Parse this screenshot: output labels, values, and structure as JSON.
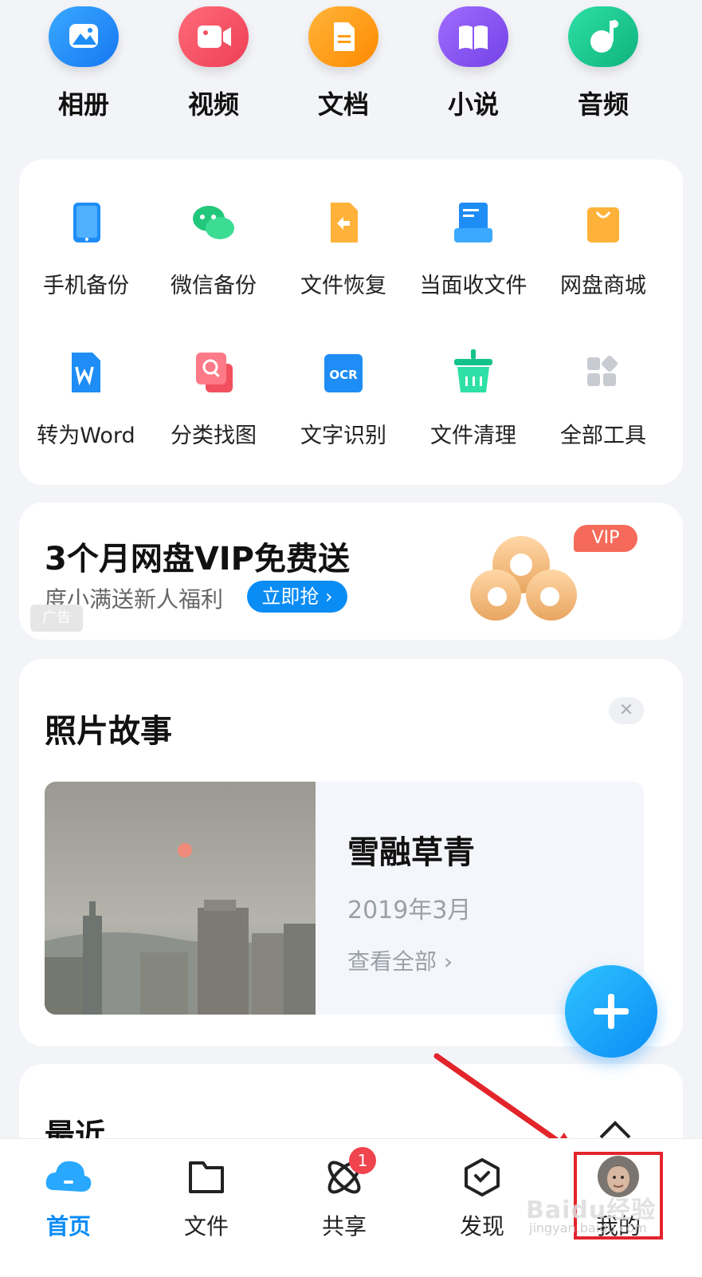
{
  "categories": [
    {
      "label": "相册",
      "icon": "photo-album-icon",
      "color": "#1e8df5"
    },
    {
      "label": "视频",
      "icon": "video-camera-icon",
      "color": "#f2505f"
    },
    {
      "label": "文档",
      "icon": "document-icon",
      "color": "#ff9d14"
    },
    {
      "label": "小说",
      "icon": "book-icon",
      "color": "#8a56f0"
    },
    {
      "label": "音频",
      "icon": "music-note-icon",
      "color": "#12c28a"
    }
  ],
  "tools": [
    {
      "label": "手机备份",
      "icon": "phone-backup-icon"
    },
    {
      "label": "微信备份",
      "icon": "wechat-backup-icon"
    },
    {
      "label": "文件恢复",
      "icon": "file-restore-icon"
    },
    {
      "label": "当面收文件",
      "icon": "receive-file-icon"
    },
    {
      "label": "网盘商城",
      "icon": "shopping-bag-icon"
    },
    {
      "label": "转为Word",
      "icon": "word-convert-icon"
    },
    {
      "label": "分类找图",
      "icon": "image-search-icon"
    },
    {
      "label": "文字识别",
      "icon": "ocr-icon",
      "icon_text": "OCR"
    },
    {
      "label": "文件清理",
      "icon": "cleanup-basket-icon"
    },
    {
      "label": "全部工具",
      "icon": "all-tools-grid-icon"
    }
  ],
  "ad": {
    "title": "3个月网盘VIP免费送",
    "subtitle": "度小满送新人福利",
    "button": "立即抢 ›",
    "tag": "广告",
    "badge": "VIP"
  },
  "story": {
    "section_title": "照片故事",
    "close": "✕",
    "name": "雪融草青",
    "date": "2019年3月",
    "view_all": "查看全部 ›"
  },
  "recent": {
    "title": "最近"
  },
  "tabbar": {
    "tabs": [
      {
        "label": "首页",
        "icon": "home-cloud-icon",
        "active": true
      },
      {
        "label": "文件",
        "icon": "folder-icon"
      },
      {
        "label": "共享",
        "icon": "share-orbit-icon",
        "badge": "1"
      },
      {
        "label": "发现",
        "icon": "discover-icon"
      },
      {
        "label": "我的",
        "icon": "avatar"
      }
    ]
  },
  "watermark": {
    "line1": "Baidu经验",
    "line2": "jingyan.baidu.com"
  },
  "colors": {
    "accent": "#0a8cf5",
    "annotation_red": "#e3242b"
  }
}
